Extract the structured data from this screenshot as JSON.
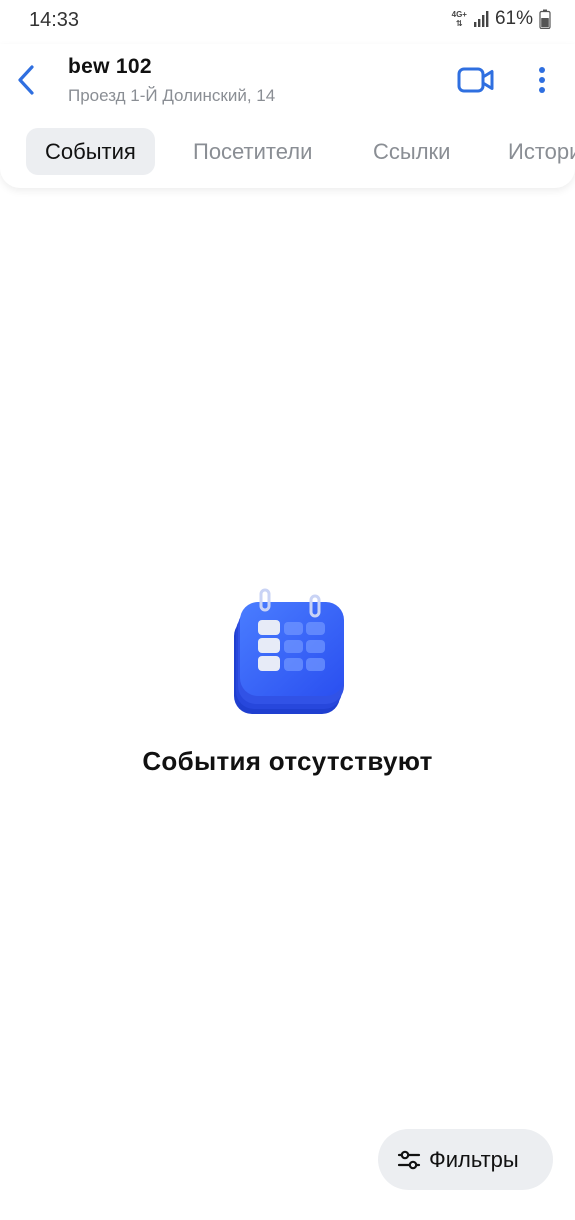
{
  "status_bar": {
    "time": "14:33",
    "network": "4G+",
    "battery": "61%"
  },
  "header": {
    "title": "bew 102",
    "subtitle": "Проезд 1-Й Долинский, 14",
    "back_icon": "chevron-left-icon",
    "video_icon": "video-camera-icon",
    "more_icon": "more-vertical-icon",
    "accent_color": "#2f6fe0"
  },
  "tabs": [
    {
      "label": "События",
      "active": true
    },
    {
      "label": "Посетители",
      "active": false
    },
    {
      "label": "Ссылки",
      "active": false
    },
    {
      "label": "История",
      "active": false
    }
  ],
  "empty_state": {
    "illustration": "calendar-icon",
    "title": "События отсутствуют"
  },
  "filters_button": {
    "label": "Фильтры",
    "icon": "sliders-icon"
  }
}
